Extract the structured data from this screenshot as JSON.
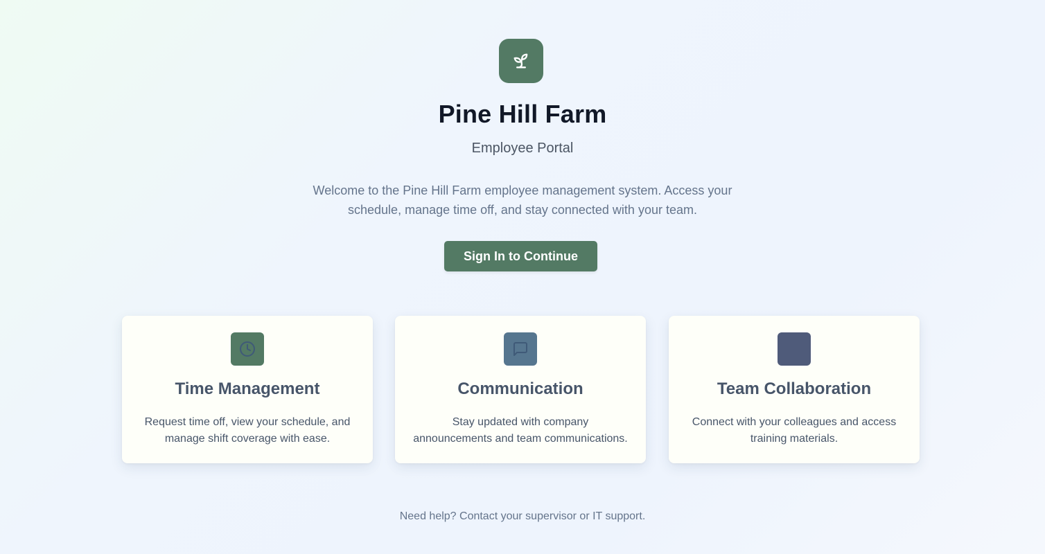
{
  "brand": {
    "title": "Pine Hill Farm",
    "subtitle": "Employee Portal",
    "logo_icon": "sprout-icon",
    "accent_color": "#537a64"
  },
  "welcome": {
    "text": "Welcome to the Pine Hill Farm employee management system. Access your schedule, manage time off, and stay connected with your team."
  },
  "actions": {
    "signin_label": "Sign In to Continue"
  },
  "features": [
    {
      "icon": "clock-icon",
      "icon_bg": "#537a64",
      "title": "Time Management",
      "description": "Request time off, view your schedule, and manage shift coverage with ease."
    },
    {
      "icon": "message-square-icon",
      "icon_bg": "#56768f",
      "title": "Communication",
      "description": "Stay updated with company announcements and team communications."
    },
    {
      "icon": "users-icon",
      "icon_bg": "#4f5b7a",
      "title": "Team Collaboration",
      "description": "Connect with your colleagues and access training materials."
    }
  ],
  "footer": {
    "help_text": "Need help? Contact your supervisor or IT support."
  }
}
